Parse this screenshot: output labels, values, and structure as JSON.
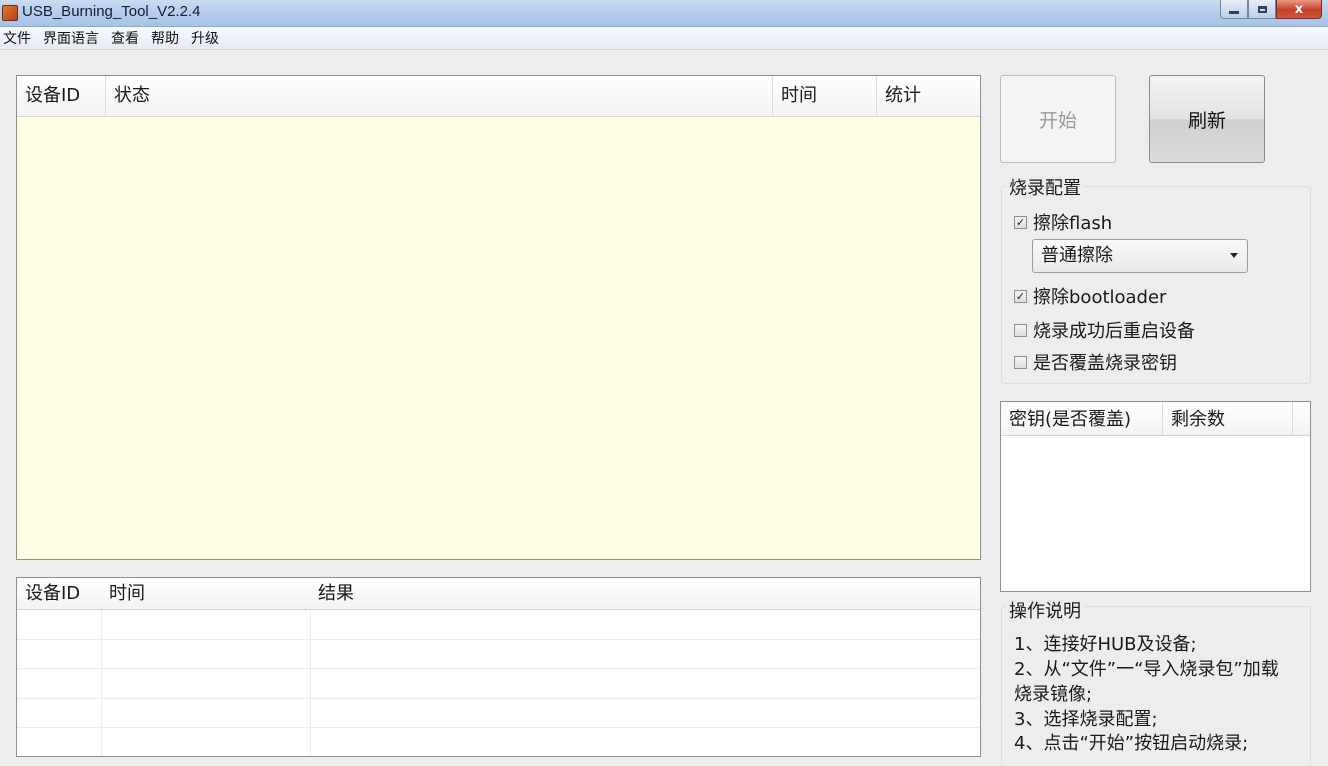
{
  "window": {
    "title": "USB_Burning_Tool_V2.2.4",
    "close_glyph": "x"
  },
  "menu": [
    {
      "label": "文件"
    },
    {
      "label": "界面语言"
    },
    {
      "label": "查看"
    },
    {
      "label": "帮助"
    },
    {
      "label": "升级"
    }
  ],
  "device_list": {
    "columns": [
      "设备ID",
      "状态",
      "时间",
      "统计"
    ],
    "background": "#ffffe3"
  },
  "result_list": {
    "columns": [
      "设备ID",
      "时间",
      "结果"
    ]
  },
  "buttons": {
    "start": {
      "label": "开始",
      "enabled": false
    },
    "refresh": {
      "label": "刷新",
      "enabled": true
    }
  },
  "burn_config": {
    "title": "烧录配置",
    "erase_flash": {
      "label": "擦除flash",
      "checked": true
    },
    "erase_mode": {
      "selected": "普通擦除"
    },
    "erase_bootloader": {
      "label": "擦除bootloader",
      "checked": true
    },
    "reboot_after_success": {
      "label": "烧录成功后重启设备",
      "checked": false
    },
    "overwrite_key": {
      "label": "是否覆盖烧录密钥",
      "checked": false
    },
    "check_mark": "✓"
  },
  "key_list": {
    "columns": [
      "密钥(是否覆盖)",
      "剩余数"
    ]
  },
  "instructions": {
    "title": "操作说明",
    "lines": [
      "1、连接好HUB及设备;",
      "2、从“文件”一“导入烧录包”加载",
      "烧录镜像;",
      "3、选择烧录配置;",
      "4、点击“开始”按钮启动烧录;"
    ]
  }
}
